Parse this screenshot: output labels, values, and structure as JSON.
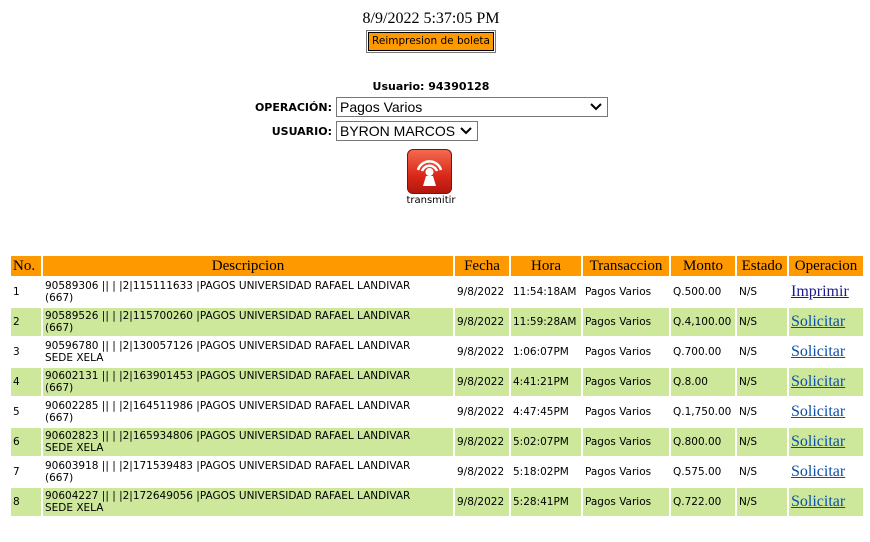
{
  "header": {
    "datetime": "8/9/2022 5:37:05 PM",
    "reprint_label": "Reimpresion de boleta",
    "usuario_line": "Usuario: 94390128"
  },
  "form": {
    "operacion_label": "OPERACIÓN:",
    "operacion_value": "Pagos Varios",
    "usuario_label": "USUARIO:",
    "usuario_value": "BYRON MARCOS"
  },
  "transmit": {
    "label": "transmitir",
    "icon": "transmit-icon"
  },
  "table": {
    "headers": [
      "No.",
      "Descripcion",
      "Fecha",
      "Hora",
      "Transaccion",
      "Monto",
      "Estado",
      "Operacion"
    ],
    "rows": [
      {
        "no": "1",
        "desc1": "90589306 || | |2|115111633 |PAGOS UNIVERSIDAD RAFAEL LANDIVAR",
        "desc2": "(667)",
        "fecha": "9/8/2022",
        "hora": "11:54:18AM",
        "trans": "Pagos Varios",
        "monto": "Q.500.00",
        "estado": "N/S",
        "op": "Imprimir"
      },
      {
        "no": "2",
        "desc1": "90589526 || | |2|115700260 |PAGOS UNIVERSIDAD RAFAEL LANDIVAR",
        "desc2": "(667)",
        "fecha": "9/8/2022",
        "hora": "11:59:28AM",
        "trans": "Pagos Varios",
        "monto": "Q.4,100.00",
        "estado": "N/S",
        "op": "Solicitar"
      },
      {
        "no": "3",
        "desc1": "90596780 || | |2|130057126 |PAGOS UNIVERSIDAD RAFAEL LANDIVAR",
        "desc2": "SEDE XELA",
        "fecha": "9/8/2022",
        "hora": "1:06:07PM",
        "trans": "Pagos Varios",
        "monto": "Q.700.00",
        "estado": "N/S",
        "op": "Solicitar"
      },
      {
        "no": "4",
        "desc1": "90602131 || | |2|163901453 |PAGOS UNIVERSIDAD RAFAEL LANDIVAR",
        "desc2": "(667)",
        "fecha": "9/8/2022",
        "hora": "4:41:21PM",
        "trans": "Pagos Varios",
        "monto": "Q.8.00",
        "estado": "N/S",
        "op": "Solicitar"
      },
      {
        "no": "5",
        "desc1": "90602285 || | |2|164511986 |PAGOS UNIVERSIDAD RAFAEL LANDIVAR",
        "desc2": "(667)",
        "fecha": "9/8/2022",
        "hora": "4:47:45PM",
        "trans": "Pagos Varios",
        "monto": "Q.1,750.00",
        "estado": "N/S",
        "op": "Solicitar"
      },
      {
        "no": "6",
        "desc1": "90602823 || | |2|165934806 |PAGOS UNIVERSIDAD RAFAEL LANDIVAR",
        "desc2": "SEDE XELA",
        "fecha": "9/8/2022",
        "hora": "5:02:07PM",
        "trans": "Pagos Varios",
        "monto": "Q.800.00",
        "estado": "N/S",
        "op": "Solicitar"
      },
      {
        "no": "7",
        "desc1": "90603918 || | |2|171539483 |PAGOS UNIVERSIDAD RAFAEL LANDIVAR",
        "desc2": "(667)",
        "fecha": "9/8/2022",
        "hora": "5:18:02PM",
        "trans": "Pagos Varios",
        "monto": "Q.575.00",
        "estado": "N/S",
        "op": "Solicitar"
      },
      {
        "no": "8",
        "desc1": "90604227 || | |2|172649056 |PAGOS UNIVERSIDAD RAFAEL LANDIVAR",
        "desc2": "SEDE XELA",
        "fecha": "9/8/2022",
        "hora": "5:28:41PM",
        "trans": "Pagos Varios",
        "monto": "Q.722.00",
        "estado": "N/S",
        "op": "Solicitar"
      }
    ]
  },
  "colors": {
    "header_bg": "#ff9900",
    "alt_row": "#cde89b",
    "link": "#0b4fa8"
  }
}
